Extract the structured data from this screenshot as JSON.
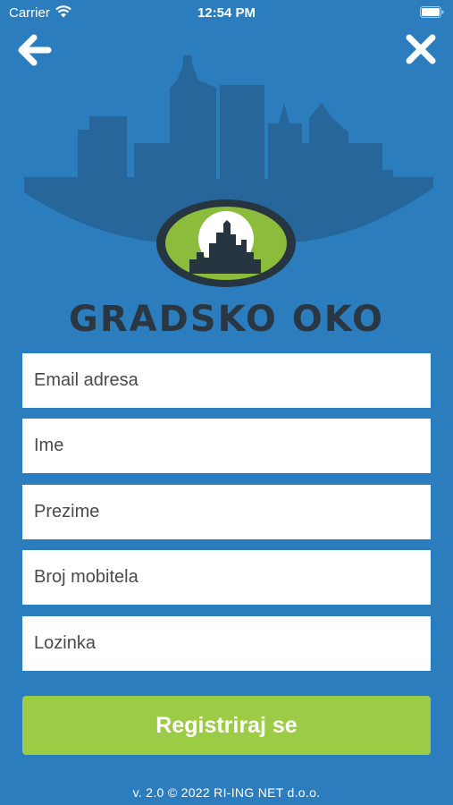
{
  "status_bar": {
    "carrier": "Carrier",
    "time": "12:54 PM",
    "icons": [
      "wifi-icon",
      "battery-icon"
    ]
  },
  "nav": {
    "back_icon": "arrow-left-icon",
    "close_icon": "close-icon"
  },
  "logo": {
    "title": "GRADSKO OKO"
  },
  "form": {
    "email_placeholder": "Email adresa",
    "first_name_placeholder": "Ime",
    "last_name_placeholder": "Prezime",
    "phone_placeholder": "Broj mobitela",
    "password_placeholder": "Lozinka",
    "register_label": "Registriraj se"
  },
  "footer": {
    "text": "v. 2.0 © 2022 RI-ING NET d.o.o."
  },
  "colors": {
    "background": "#2c7dbd",
    "accent_green": "#9ccc45",
    "skyline": "#26669b",
    "title_dark": "#2a3742"
  }
}
